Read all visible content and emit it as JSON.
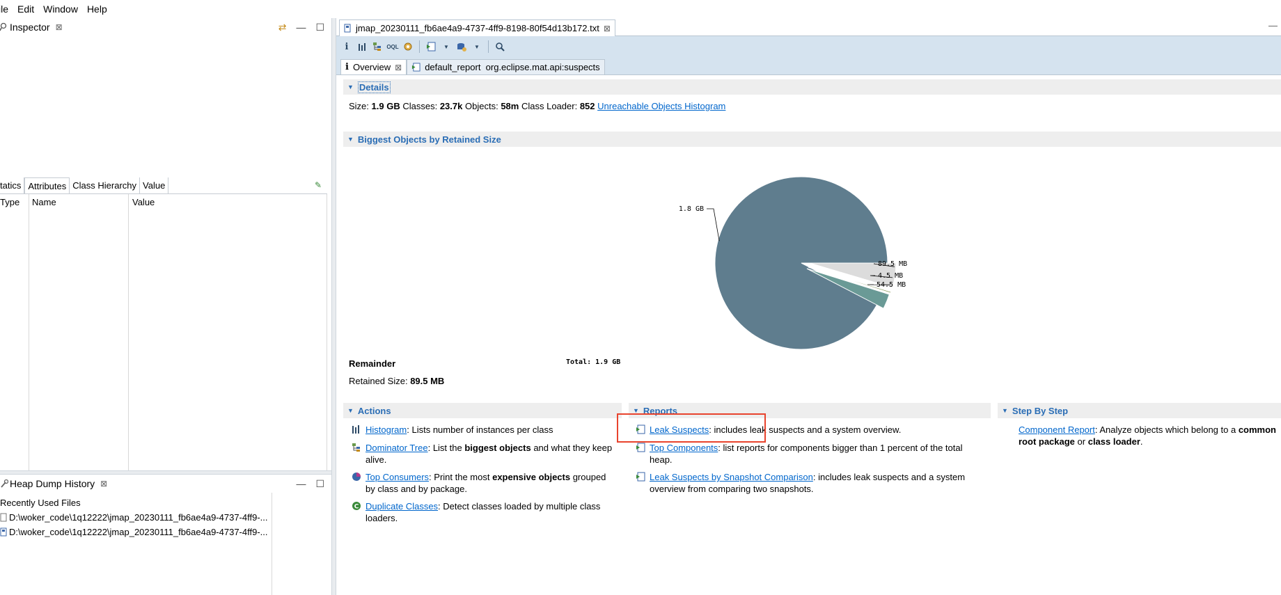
{
  "menu": [
    "ile",
    "Edit",
    "Window",
    "Help"
  ],
  "inspector": {
    "tab_label": "Inspector",
    "subtabs": [
      "tatics",
      "Attributes",
      "Class Hierarchy",
      "Value"
    ],
    "columns": [
      "Type",
      "Name",
      "Value"
    ]
  },
  "heap_history": {
    "tab_label": "Heap Dump History",
    "heading": "Recently Used Files",
    "files": [
      "D:\\woker_code\\1q12222\\jmap_20230111_fb6ae4a9-4737-4ff9-...",
      "D:\\woker_code\\1q12222\\jmap_20230111_fb6ae4a9-4737-4ff9-..."
    ]
  },
  "editor": {
    "tab_label": "jmap_20230111_fb6ae4a9-4737-4ff9-8198-80f54d13b172.txt",
    "subtabs": [
      "Overview",
      "default_report  org.eclipse.mat.api:suspects"
    ]
  },
  "details": {
    "header": "Details",
    "size_label": "Size:",
    "size_value": "1.9 GB",
    "classes_label": "Classes:",
    "classes_value": "23.7k",
    "objects_label": "Objects:",
    "objects_value": "58m",
    "loader_label": "Class Loader:",
    "loader_value": "852",
    "histogram_link": "Unreachable Objects Histogram"
  },
  "biggest": {
    "header": "Biggest Objects by Retained Size",
    "remainder_title": "Remainder",
    "retained_label": "Retained Size:",
    "retained_value": "89.5 MB"
  },
  "chart_data": {
    "type": "pie",
    "slices": [
      {
        "label": "1.8 GB",
        "value": 1.8,
        "color": "#5f7d8e"
      },
      {
        "label": "89.5 MB",
        "value": 0.0895,
        "color": "#dcdcdc"
      },
      {
        "label": "4.5 MB",
        "value": 0.0045,
        "color": "#8a9a5b"
      },
      {
        "label": "54.5 MB",
        "value": 0.0545,
        "color": "#6a9a96"
      }
    ],
    "total_label": "Total: 1.9 GB"
  },
  "actions": {
    "header": "Actions",
    "items": [
      {
        "link": "Histogram",
        "text_before": ": Lists number of instances per class",
        "bold": "",
        "text_after": ""
      },
      {
        "link": "Dominator Tree",
        "text_before": ": List the ",
        "bold": "biggest objects",
        "text_after": " and what they keep alive."
      },
      {
        "link": "Top Consumers",
        "text_before": ": Print the most ",
        "bold": "expensive objects",
        "text_after": " grouped by class and by package."
      },
      {
        "link": "Duplicate Classes",
        "text_before": ": Detect classes loaded by multiple class loaders.",
        "bold": "",
        "text_after": ""
      }
    ]
  },
  "reports": {
    "header": "Reports",
    "items": [
      {
        "link": "Leak Suspects",
        "text": ": includes leak suspects and a system overview."
      },
      {
        "link": "Top Components",
        "text": ": list reports for components bigger than 1 percent of the total heap."
      },
      {
        "link": "Leak Suspects by Snapshot Comparison",
        "text": ": includes leak suspects and a system overview from comparing two snapshots."
      }
    ]
  },
  "stepbystep": {
    "header": "Step By Step",
    "link": "Component Report",
    "text1": ": Analyze objects which belong to a ",
    "bold1": "common root package",
    "text2": " or ",
    "bold2": "class loader",
    "text3": "."
  }
}
